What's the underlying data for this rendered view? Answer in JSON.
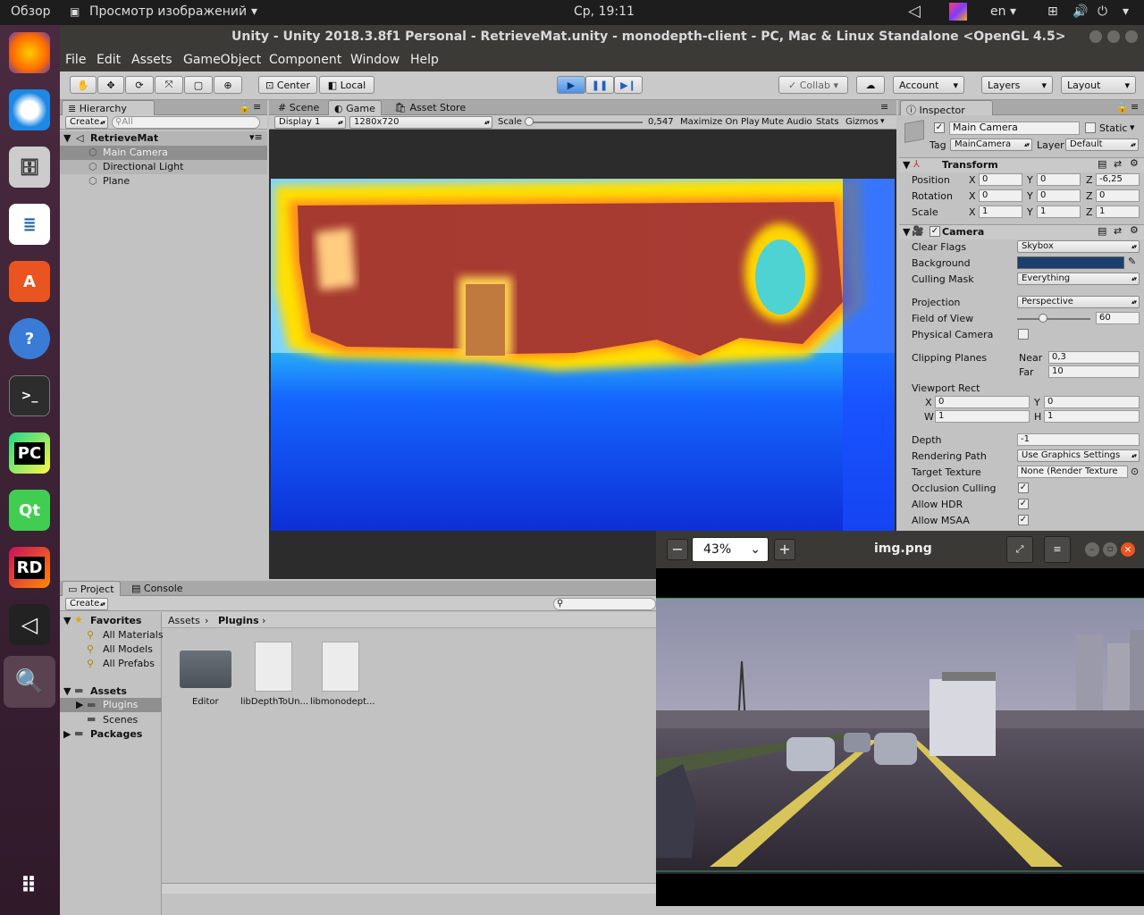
{
  "topbar": {
    "overview": "Обзор",
    "app": "Просмотр изображений",
    "clock": "Ср, 19:11",
    "lang": "en"
  },
  "titlebar": {
    "title": "Unity - Unity 2018.3.8f1 Personal - RetrieveMat.unity - monodepth-client - PC, Mac & Linux Standalone <OpenGL 4.5>"
  },
  "menu": {
    "file": "File",
    "edit": "Edit",
    "assets": "Assets",
    "gameobject": "GameObject",
    "component": "Component",
    "window": "Window",
    "help": "Help"
  },
  "toolbar": {
    "center": "Center",
    "local": "Local",
    "collab": "Collab",
    "account": "Account",
    "layers": "Layers",
    "layout": "Layout"
  },
  "hierarchy": {
    "tab": "Hierarchy",
    "create": "Create",
    "search": "All",
    "scene": "RetrieveMat",
    "items": [
      "Main Camera",
      "Directional Light",
      "Plane"
    ]
  },
  "game": {
    "tab_scene": "Scene",
    "tab_game": "Game",
    "tab_store": "Asset Store",
    "display": "Display 1",
    "resolution": "1280x720",
    "scale_label": "Scale",
    "scale_value": "0,547",
    "maximize": "Maximize On Play",
    "mute": "Mute Audio",
    "stats": "Stats",
    "gizmos": "Gizmos"
  },
  "inspector": {
    "tab": "Inspector",
    "name": "Main Camera",
    "static": "Static",
    "tag_label": "Tag",
    "tag": "MainCamera",
    "layer_label": "Layer",
    "layer": "Default",
    "transform": {
      "title": "Transform",
      "position": "Position",
      "rotation": "Rotation",
      "scale": "Scale",
      "px": "0",
      "py": "0",
      "pz": "-6,25",
      "rx": "0",
      "ry": "0",
      "rz": "0",
      "sx": "1",
      "sy": "1",
      "sz": "1",
      "x": "X",
      "y": "Y",
      "z": "Z"
    },
    "camera": {
      "title": "Camera",
      "clear_flags": "Clear Flags",
      "clear_flags_val": "Skybox",
      "background": "Background",
      "culling": "Culling Mask",
      "culling_val": "Everything",
      "projection": "Projection",
      "projection_val": "Perspective",
      "fov": "Field of View",
      "fov_val": "60",
      "physical": "Physical Camera",
      "clipping": "Clipping Planes",
      "near": "Near",
      "near_val": "0,3",
      "far": "Far",
      "far_val": "10",
      "viewport": "Viewport Rect",
      "vx": "0",
      "vy": "0",
      "vw": "1",
      "vh": "1",
      "w": "W",
      "h": "H",
      "depth": "Depth",
      "depth_val": "-1",
      "rendering": "Rendering Path",
      "rendering_val": "Use Graphics Settings",
      "target": "Target Texture",
      "target_val": "None (Render Texture",
      "occlusion": "Occlusion Culling",
      "hdr": "Allow HDR",
      "msaa": "Allow MSAA"
    },
    "bg_color": "#1c3f6e"
  },
  "project": {
    "tab_project": "Project",
    "tab_console": "Console",
    "create": "Create",
    "favorites": "Favorites",
    "fav_items": [
      "All Materials",
      "All Models",
      "All Prefabs"
    ],
    "assets": "Assets",
    "asset_items": [
      "Plugins",
      "Scenes"
    ],
    "packages": "Packages",
    "crumb_assets": "Assets",
    "crumb_plugins": "Plugins",
    "files": [
      "Editor",
      "libDepthToUn...",
      "libmonodept..."
    ]
  },
  "viewer": {
    "zoom": "43%",
    "title": "img.png"
  }
}
